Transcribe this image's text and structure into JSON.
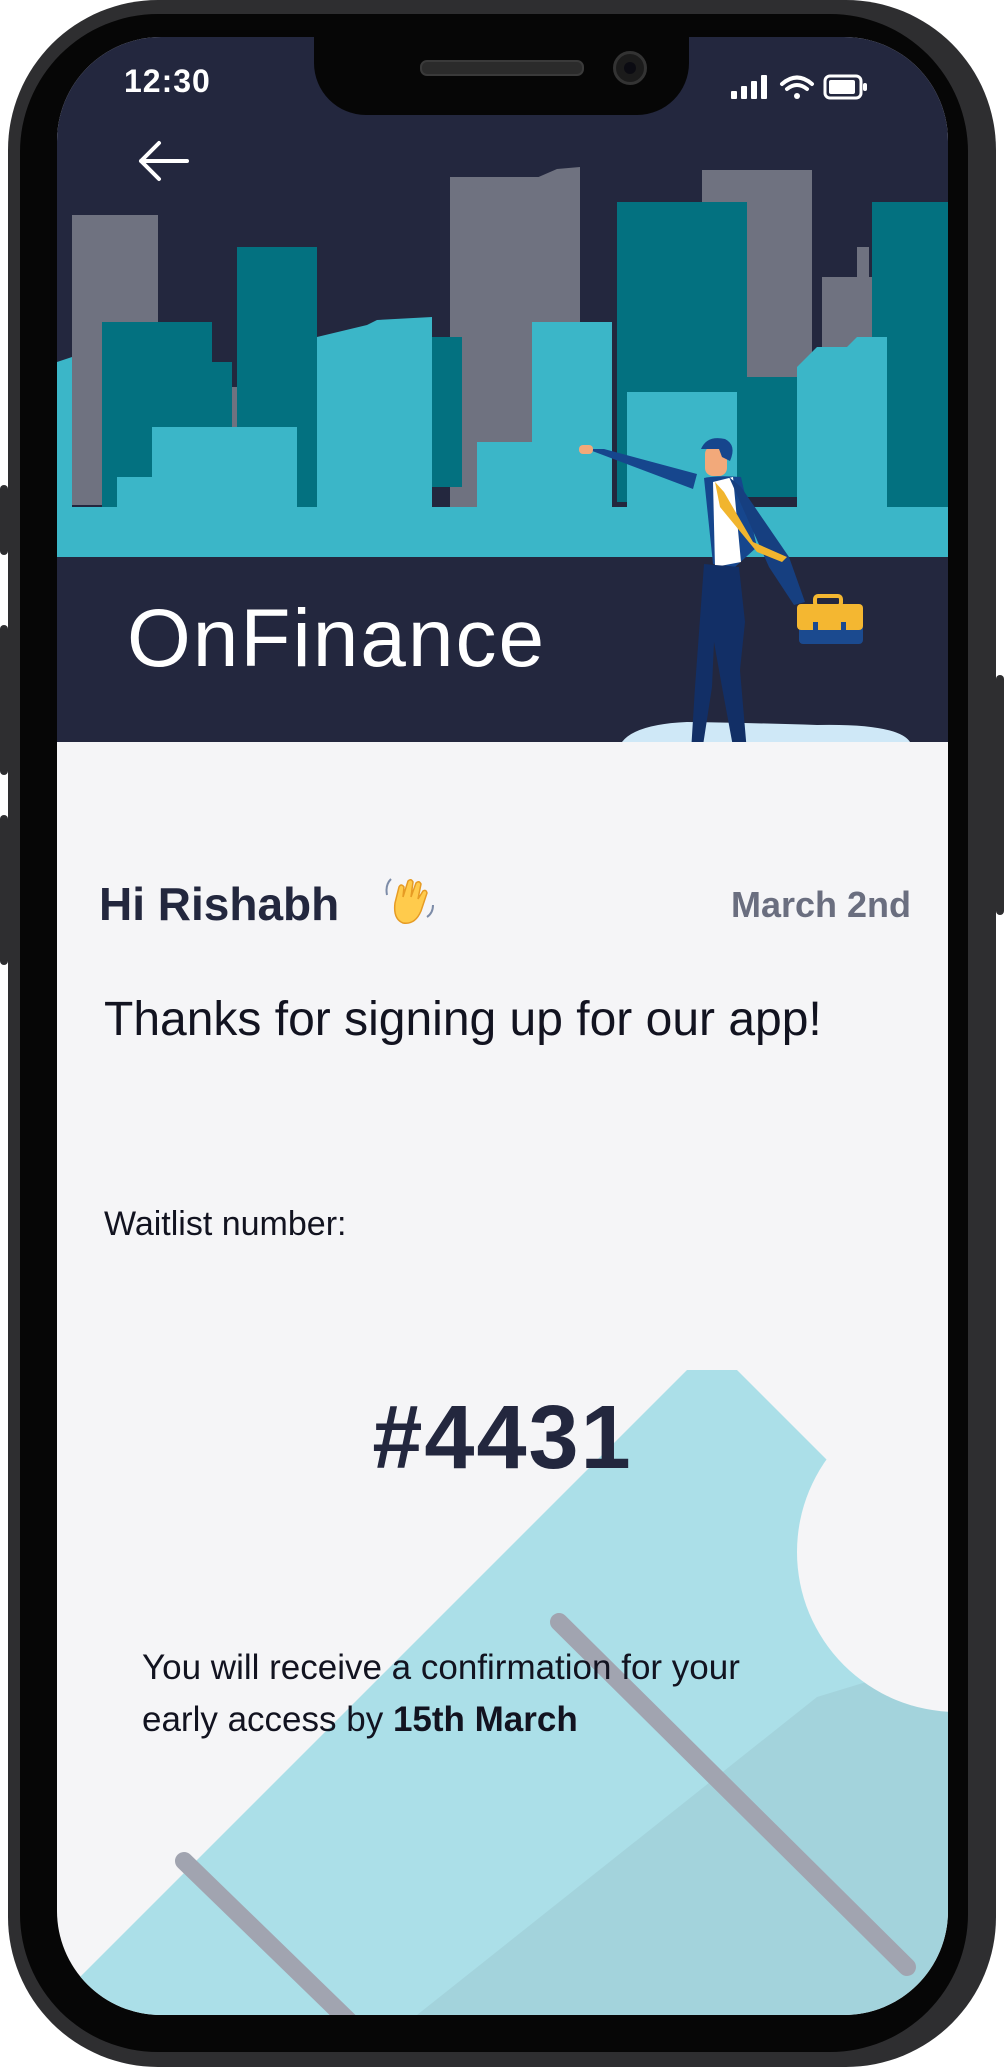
{
  "status_bar": {
    "time": "12:30",
    "icons": [
      "signal-icon",
      "wifi-icon",
      "battery-icon"
    ]
  },
  "header": {
    "back_icon": "arrow-left-icon",
    "brand": "OnFinance"
  },
  "greeting": {
    "text": "Hi Rishabh",
    "emoji": "waving-hand-icon",
    "date": "March 2nd"
  },
  "main": {
    "headline": "Thanks for signing up for our app!",
    "waitlist_label": "Waitlist number:",
    "waitlist_number": "#4431",
    "confirmation_prefix": "You will receive a confirmation for your early access by ",
    "confirmation_date": "15th March"
  },
  "colors": {
    "header_bg": "#23273e",
    "accent_teal": "#3bb6c8",
    "dark_teal": "#037180",
    "ticket_bg": "#abdfe8",
    "text_dark": "#23273e",
    "date_text": "#6a6e7f"
  }
}
